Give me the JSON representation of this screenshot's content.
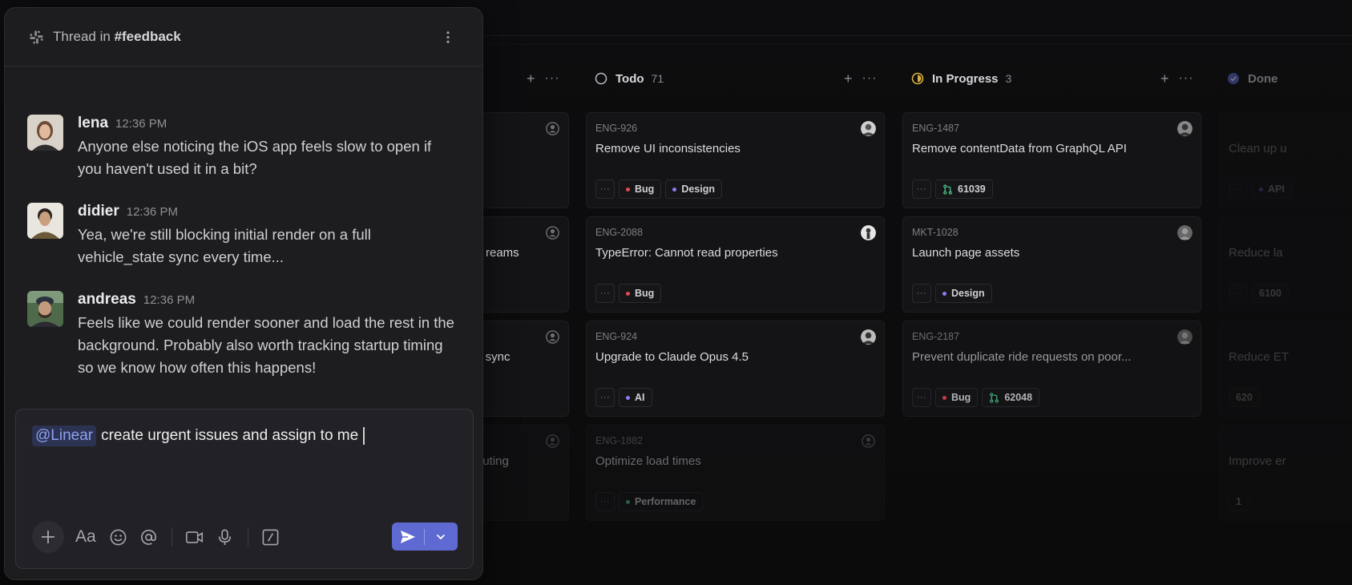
{
  "board": {
    "columns": [
      {
        "title": "Todo",
        "count": "71"
      },
      {
        "title": "In Progress",
        "count": "3"
      },
      {
        "title": "Done",
        "count": ""
      }
    ],
    "partial_cards": [
      {
        "title_tail": ""
      },
      {
        "title_tail": "reams"
      },
      {
        "title_tail": "icle sync"
      },
      {
        "title_tail": "outing"
      }
    ],
    "todo_cards": [
      {
        "id": "ENG-926",
        "title": "Remove UI inconsistencies",
        "tags": [
          {
            "label": "Bug",
            "color": "#e5484d"
          },
          {
            "label": "Design",
            "color": "#8e7cf0"
          }
        ]
      },
      {
        "id": "ENG-2088",
        "title": "TypeError: Cannot read properties",
        "tags": [
          {
            "label": "Bug",
            "color": "#e5484d"
          }
        ]
      },
      {
        "id": "ENG-924",
        "title": "Upgrade to Claude Opus 4.5",
        "tags": [
          {
            "label": "AI",
            "color": "#8e7cf0"
          }
        ]
      },
      {
        "id": "ENG-1882",
        "title": "Optimize load times",
        "tags": [
          {
            "label": "Performance",
            "color": "#4cc38a"
          }
        ]
      }
    ],
    "progress_cards": [
      {
        "id": "ENG-1487",
        "title": "Remove contentData from GraphQL API",
        "pr": "61039"
      },
      {
        "id": "MKT-1028",
        "title": "Launch page assets",
        "tag": {
          "label": "Design",
          "color": "#8e7cf0"
        }
      },
      {
        "id": "ENG-2187",
        "title": "Prevent duplicate ride requests on poor...",
        "tag": {
          "label": "Bug",
          "color": "#e5484d"
        },
        "pr": "62048"
      }
    ],
    "done_cards": [
      {
        "title": "Clean up u",
        "tag": "API"
      },
      {
        "title": "Reduce la",
        "pr": "6100"
      },
      {
        "title": "Reduce ET",
        "pr": "620"
      },
      {
        "title": "Improve er",
        "pr": "1"
      }
    ],
    "more_label": "···"
  },
  "thread": {
    "title_prefix": "Thread in",
    "channel": "#feedback",
    "messages": [
      {
        "name": "lena",
        "time": "12:36 PM",
        "text": "Anyone else noticing the iOS app feels slow to open if you haven't used it in a bit?"
      },
      {
        "name": "didier",
        "time": "12:36 PM",
        "text": "Yea, we're still blocking initial render on a full vehicle_state sync every time..."
      },
      {
        "name": "andreas",
        "time": "12:36 PM",
        "text": "Feels like we could render sooner and load the rest in the background. Probably also worth tracking startup timing so we know how often this happens!"
      }
    ],
    "composer": {
      "mention": "@Linear",
      "text": "create urgent issues and assign to me"
    },
    "toolbar": {
      "format_label": "Aa"
    }
  },
  "colors": {
    "accent": "#5e6ad2",
    "progress": "#d9b13a",
    "done": "#5e6ad2",
    "pr_green": "#4cc38a"
  },
  "icons": [
    "slack-icon",
    "kebab-icon",
    "plus-icon",
    "emoji-icon",
    "at-icon",
    "video-icon",
    "mic-icon",
    "slash-command-icon",
    "send-icon",
    "chevron-down-icon"
  ]
}
